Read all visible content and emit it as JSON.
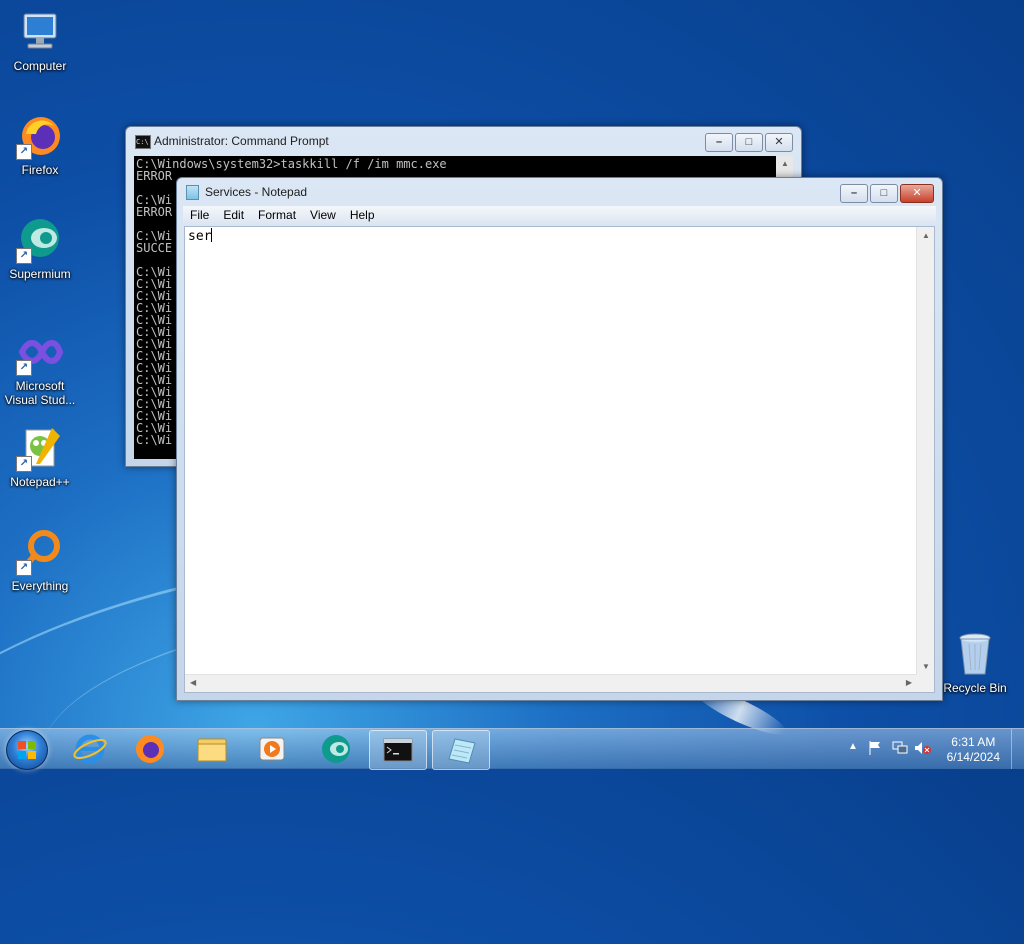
{
  "desktop": {
    "icons": [
      {
        "label": "Computer"
      },
      {
        "label": "Firefox"
      },
      {
        "label": "Supermium"
      },
      {
        "label": "Microsoft Visual Studio Code",
        "display": "Microsoft\nVisual Stud..."
      },
      {
        "label": "Notepad++"
      },
      {
        "label": "Everything"
      },
      {
        "label": "Recycle Bin"
      }
    ]
  },
  "cmd_window": {
    "title": "Administrator: Command Prompt",
    "console_text": "C:\\Windows\\system32>taskkill /f /im mmc.exe\nERROR\n\nC:\\Wi\nERROR\n\nC:\\Wi\nSUCCE\n\nC:\\Wi\nC:\\Wi\nC:\\Wi\nC:\\Wi\nC:\\Wi\nC:\\Wi\nC:\\Wi\nC:\\Wi\nC:\\Wi\nC:\\Wi\nC:\\Wi\nC:\\Wi\nC:\\Wi\nC:\\Wi\nC:\\Wi"
  },
  "notepad_window": {
    "title": "Services - Notepad",
    "menu": [
      "File",
      "Edit",
      "Format",
      "View",
      "Help"
    ],
    "content": "ser"
  },
  "taskbar": {
    "pinned": [
      "Internet Explorer",
      "Firefox",
      "Windows Explorer",
      "Windows Media Player",
      "Supermium",
      "Command Prompt",
      "Notepad"
    ],
    "clock_time": "6:31 AM",
    "clock_date": "6/14/2024"
  }
}
